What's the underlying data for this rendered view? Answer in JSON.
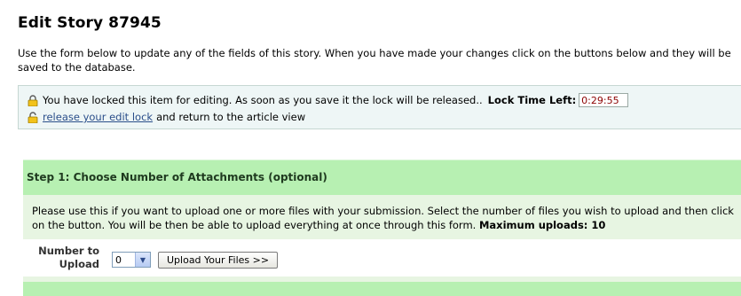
{
  "page": {
    "title": "Edit Story 87945",
    "intro": "Use the form below to update any of the fields of this story. When you have made your changes click on the buttons below and they will be saved to the database."
  },
  "lock": {
    "message": "You have locked this item for editing. As soon as you save it the lock will be released..",
    "time_left_label": "Lock Time Left:",
    "time_left_value": "0:29:55",
    "release_link": "release your edit lock",
    "release_suffix": "and return to the article view"
  },
  "step1": {
    "title": "Step 1: Choose Number of Attachments (optional)",
    "description": "Please use this if you want to upload one or more files with your submission. Select the number of files you wish to upload and then click on the button. You will be then be able to upload everything at once through this form.",
    "max_uploads": "Maximum uploads: 10",
    "number_label_line1": "Number to",
    "number_label_line2": "Upload",
    "selected_count": "0",
    "upload_button": "Upload Your Files >>"
  },
  "colors": {
    "step_header_bg": "#b7f0b2",
    "step_body_bg": "#e7f5e2",
    "lock_box_bg": "#eef6f6",
    "link": "#2a4e8a"
  }
}
